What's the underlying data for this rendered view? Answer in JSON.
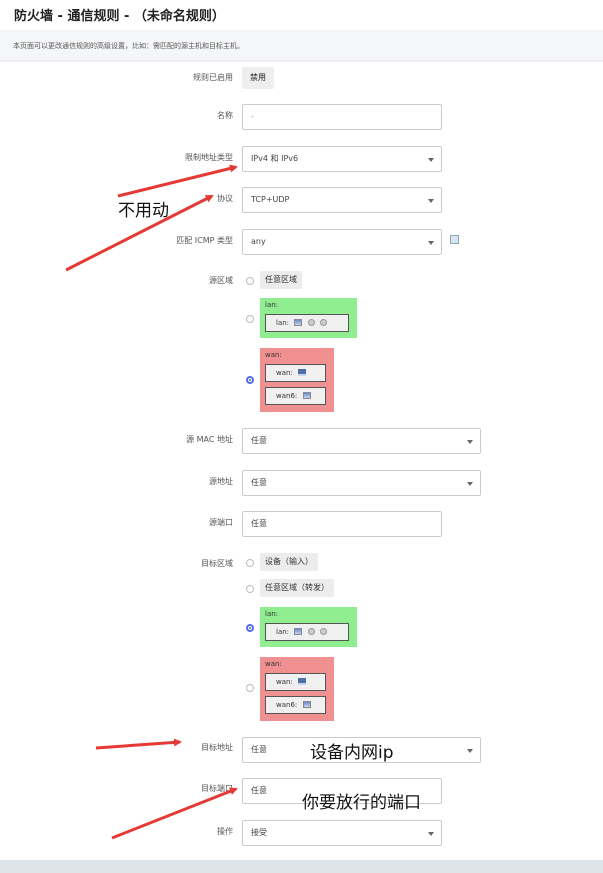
{
  "header": {
    "title": "防火墙 - 通信规则 - （未命名规则）",
    "description": "本页面可以更改通信规则的高级设置，比如：需匹配的源主机和目标主机。"
  },
  "form": {
    "enabled": {
      "label": "规则已启用",
      "value": "禁用"
    },
    "name": {
      "label": "名称",
      "placeholder": "-"
    },
    "family": {
      "label": "限制地址类型",
      "value": "IPv4 和 IPv6"
    },
    "proto": {
      "label": "协议",
      "value": "TCP+UDP"
    },
    "icmp": {
      "label": "匹配 ICMP 类型",
      "value": "any"
    },
    "src_zone": {
      "label": "源区域",
      "any_label": "任意区域",
      "lan": {
        "name": "lan:",
        "iface": "lan:"
      },
      "wan": {
        "name": "wan:",
        "iface1": "wan:",
        "iface2": "wan6:"
      },
      "selected": "wan"
    },
    "src_mac": {
      "label": "源 MAC 地址",
      "value": "任意"
    },
    "src_ip": {
      "label": "源地址",
      "value": "任意"
    },
    "src_port": {
      "label": "源端口",
      "value": "任意"
    },
    "dest_zone": {
      "label": "目标区域",
      "device_label": "设备（输入）",
      "any_label": "任意区域（转发）",
      "lan": {
        "name": "lan:",
        "iface": "lan:"
      },
      "wan": {
        "name": "wan:",
        "iface1": "wan:",
        "iface2": "wan6:"
      },
      "selected": "lan"
    },
    "dest_ip": {
      "label": "目标地址",
      "value": "任意"
    },
    "dest_port": {
      "label": "目标端口",
      "value": "任意"
    },
    "target": {
      "label": "操作",
      "value": "接受"
    }
  },
  "annotations": {
    "unused": "不用动",
    "lan_ip": "设备内网ip",
    "port": "你要放行的端口"
  },
  "colors": {
    "lan_zone": "#90ee90",
    "wan_zone": "#f09090",
    "radio_checked": "#5b6ee1",
    "arrow": "#e53935"
  }
}
